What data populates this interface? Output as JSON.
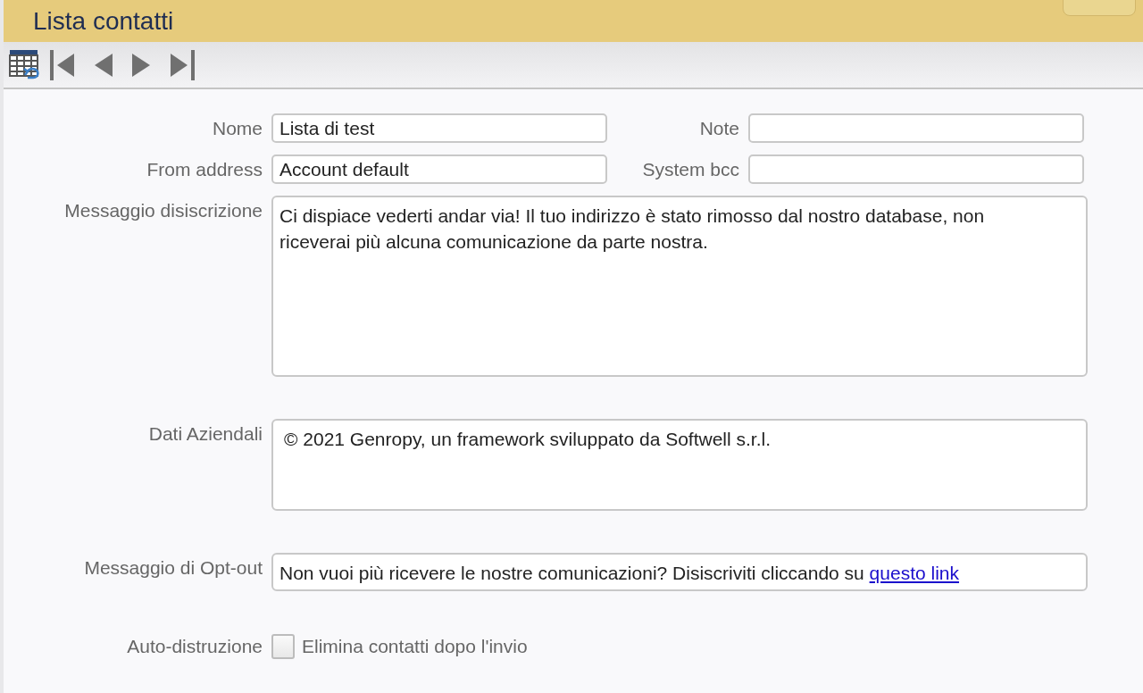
{
  "window": {
    "title": "Lista contatti"
  },
  "fields": [
    {
      "kind": "input",
      "label": "Nome",
      "value": "Lista di test"
    },
    {
      "kind": "input",
      "label": "Note"
    },
    {
      "kind": "input",
      "label": "From address",
      "value": "Account default"
    },
    {
      "kind": "input",
      "label": "System bcc"
    }
  ],
  "unsubscribe_message": {
    "label": "Messaggio disiscrizione",
    "value": "Ci dispiace vederti andar via! Il tuo indirizzo è stato rimosso dal nostro database, non riceverai più alcuna comunicazione da parte nostra."
  },
  "company_data": {
    "label": "Dati Aziendali",
    "value": "© 2021 Genropy, un framework sviluppato da Softwell s.r.l."
  },
  "opt_out_message": {
    "label": "Messaggio di Opt-out",
    "text": "Non vuoi più ricevere le nostre comunicazioni? Disiscriviti cliccando su",
    "link": "questo link"
  },
  "auto_destroy": {
    "label": "Auto-distruzione",
    "option": "Elimina contatti dopo l'invio",
    "checked": false
  }
}
